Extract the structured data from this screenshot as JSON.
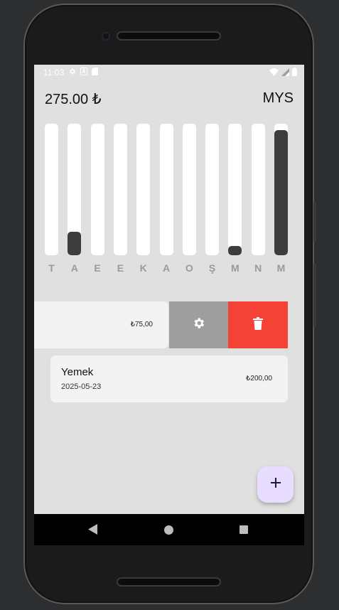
{
  "status_bar": {
    "time": "11:03",
    "left_icons": [
      "settings-icon",
      "app-notification-icon",
      "sd-card-icon"
    ],
    "right_icons": [
      "wifi-icon",
      "signal-icon",
      "battery-icon"
    ]
  },
  "header": {
    "total": "275.00 ₺",
    "month": "MYS"
  },
  "chart_data": {
    "type": "bar",
    "categories": [
      "T",
      "A",
      "E",
      "E",
      "K",
      "A",
      "O",
      "Ş",
      "M",
      "N",
      "M"
    ],
    "values": [
      0,
      0.18,
      0,
      0,
      0,
      0,
      0,
      0,
      0.07,
      0,
      0.95
    ],
    "ylim": [
      0,
      1
    ]
  },
  "transactions": [
    {
      "title": "",
      "date": "",
      "amount": "₺75,00",
      "swiped": true
    },
    {
      "title": "Yemek",
      "date": "2025-05-23",
      "amount": "₺200,00",
      "swiped": false
    }
  ],
  "actions": {
    "settings_icon": "gear-icon",
    "delete_icon": "trash-icon",
    "add_icon": "plus-icon"
  },
  "colors": {
    "delete": "#f44336",
    "settings": "#9e9e9e",
    "bar_fill": "#3d3d3d",
    "fab": "#e8ddff"
  }
}
